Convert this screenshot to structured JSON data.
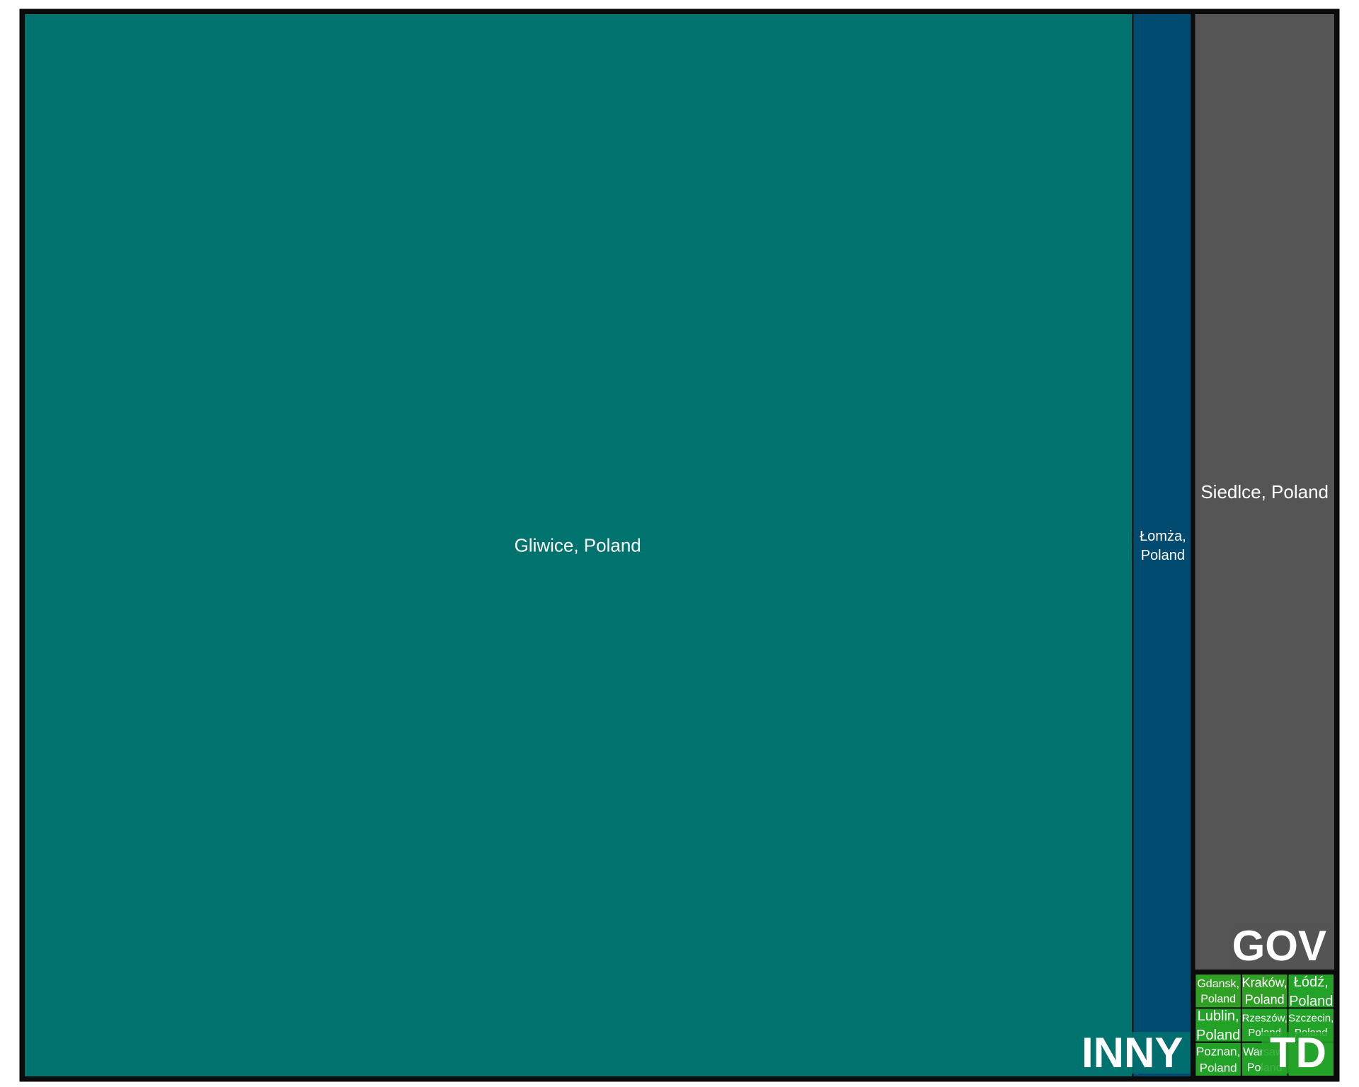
{
  "chart_data": {
    "type": "treemap",
    "groups": [
      {
        "name": "INNY",
        "color": "#00736F",
        "items": [
          {
            "label": "Gliwice, Poland",
            "value": 1531000,
            "color": "#00736F"
          },
          {
            "label": "Łomża, Poland",
            "value": 83000,
            "color": "#014A70"
          }
        ]
      },
      {
        "name": "GOV",
        "color": "#555555",
        "items": [
          {
            "label": "Siedlce, Poland",
            "value": 178000,
            "color": "#555555"
          }
        ]
      },
      {
        "name": "TD",
        "color": "#22A328",
        "items": [
          {
            "label": "Gdansk, Poland",
            "value": 2200,
            "color": "#2FA024"
          },
          {
            "label": "Kraków, Poland",
            "value": 2200,
            "color": "#2FA024"
          },
          {
            "label": "Łódź, Poland",
            "value": 2200,
            "color": "#22A328"
          },
          {
            "label": "Lublin, Poland",
            "value": 2200,
            "color": "#22A328"
          },
          {
            "label": "Rzeszów, Poland",
            "value": 2200,
            "color": "#22A328"
          },
          {
            "label": "Szczecin, Poland",
            "value": 2200,
            "color": "#22A328"
          },
          {
            "label": "Poznan, Poland",
            "value": 2200,
            "color": "#22A328"
          },
          {
            "label": "Warsaw, Poland",
            "value": 2200,
            "color": "#22A328"
          },
          {
            "label": "",
            "value": 2200,
            "color": "#2AA52E"
          }
        ]
      }
    ]
  }
}
